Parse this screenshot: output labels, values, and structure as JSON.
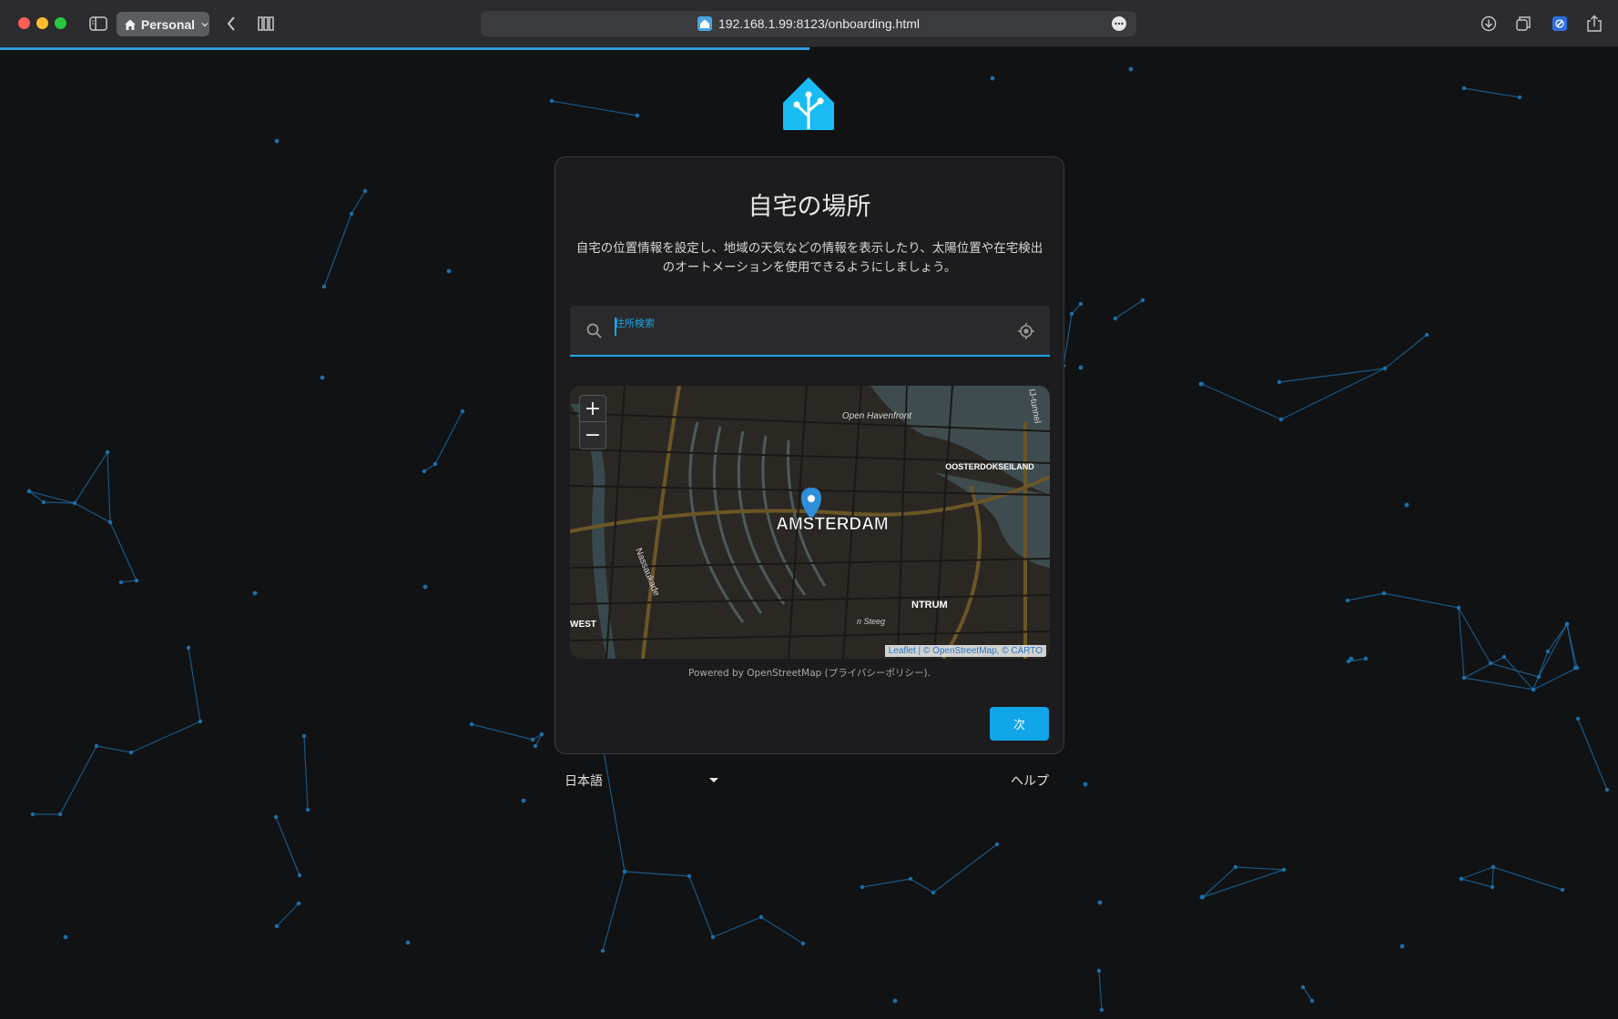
{
  "browser": {
    "profile_label": "Personal",
    "url": "192.168.1.99:8123/onboarding.html",
    "icons": {
      "sidebar": "sidebar-icon",
      "back": "chevron-left-icon",
      "bookmarks": "books-icon",
      "more": "ellipsis-icon",
      "download": "download-icon",
      "tabs": "tabs-icon",
      "extension": "extension-icon",
      "share": "share-icon"
    },
    "page_load_progress": 0.5
  },
  "onboarding": {
    "title": "自宅の場所",
    "description": "自宅の位置情報を設定し、地域の天気などの情報を表示したり、太陽位置や在宅検出のオートメーションを使用できるようにしましょう。",
    "search": {
      "label": "住所検索",
      "value": ""
    },
    "map": {
      "labels": {
        "city": "AMSTERDAM",
        "havenfront": "Open Havenfront",
        "oosterdok": "OOSTERDOKSEILAND",
        "nassaukade": "Nassaukade",
        "centrum": "NTRUM",
        "west": "WEST",
        "tunnel": "IJ-tunnel",
        "steeg": "n Steeg"
      },
      "zoom_in": "+",
      "zoom_out": "−",
      "attribution": "Leaflet | © OpenStreetMap, © CARTO"
    },
    "powered_by": "Powered by OpenStreetMap (プライバシーポリシー).",
    "next_label": "次",
    "language": "日本語",
    "help": "ヘルプ"
  },
  "colors": {
    "accent": "#1aa7e8",
    "background": "#111214",
    "card": "#1c1c1e",
    "constellation": "#1d6fa8"
  }
}
